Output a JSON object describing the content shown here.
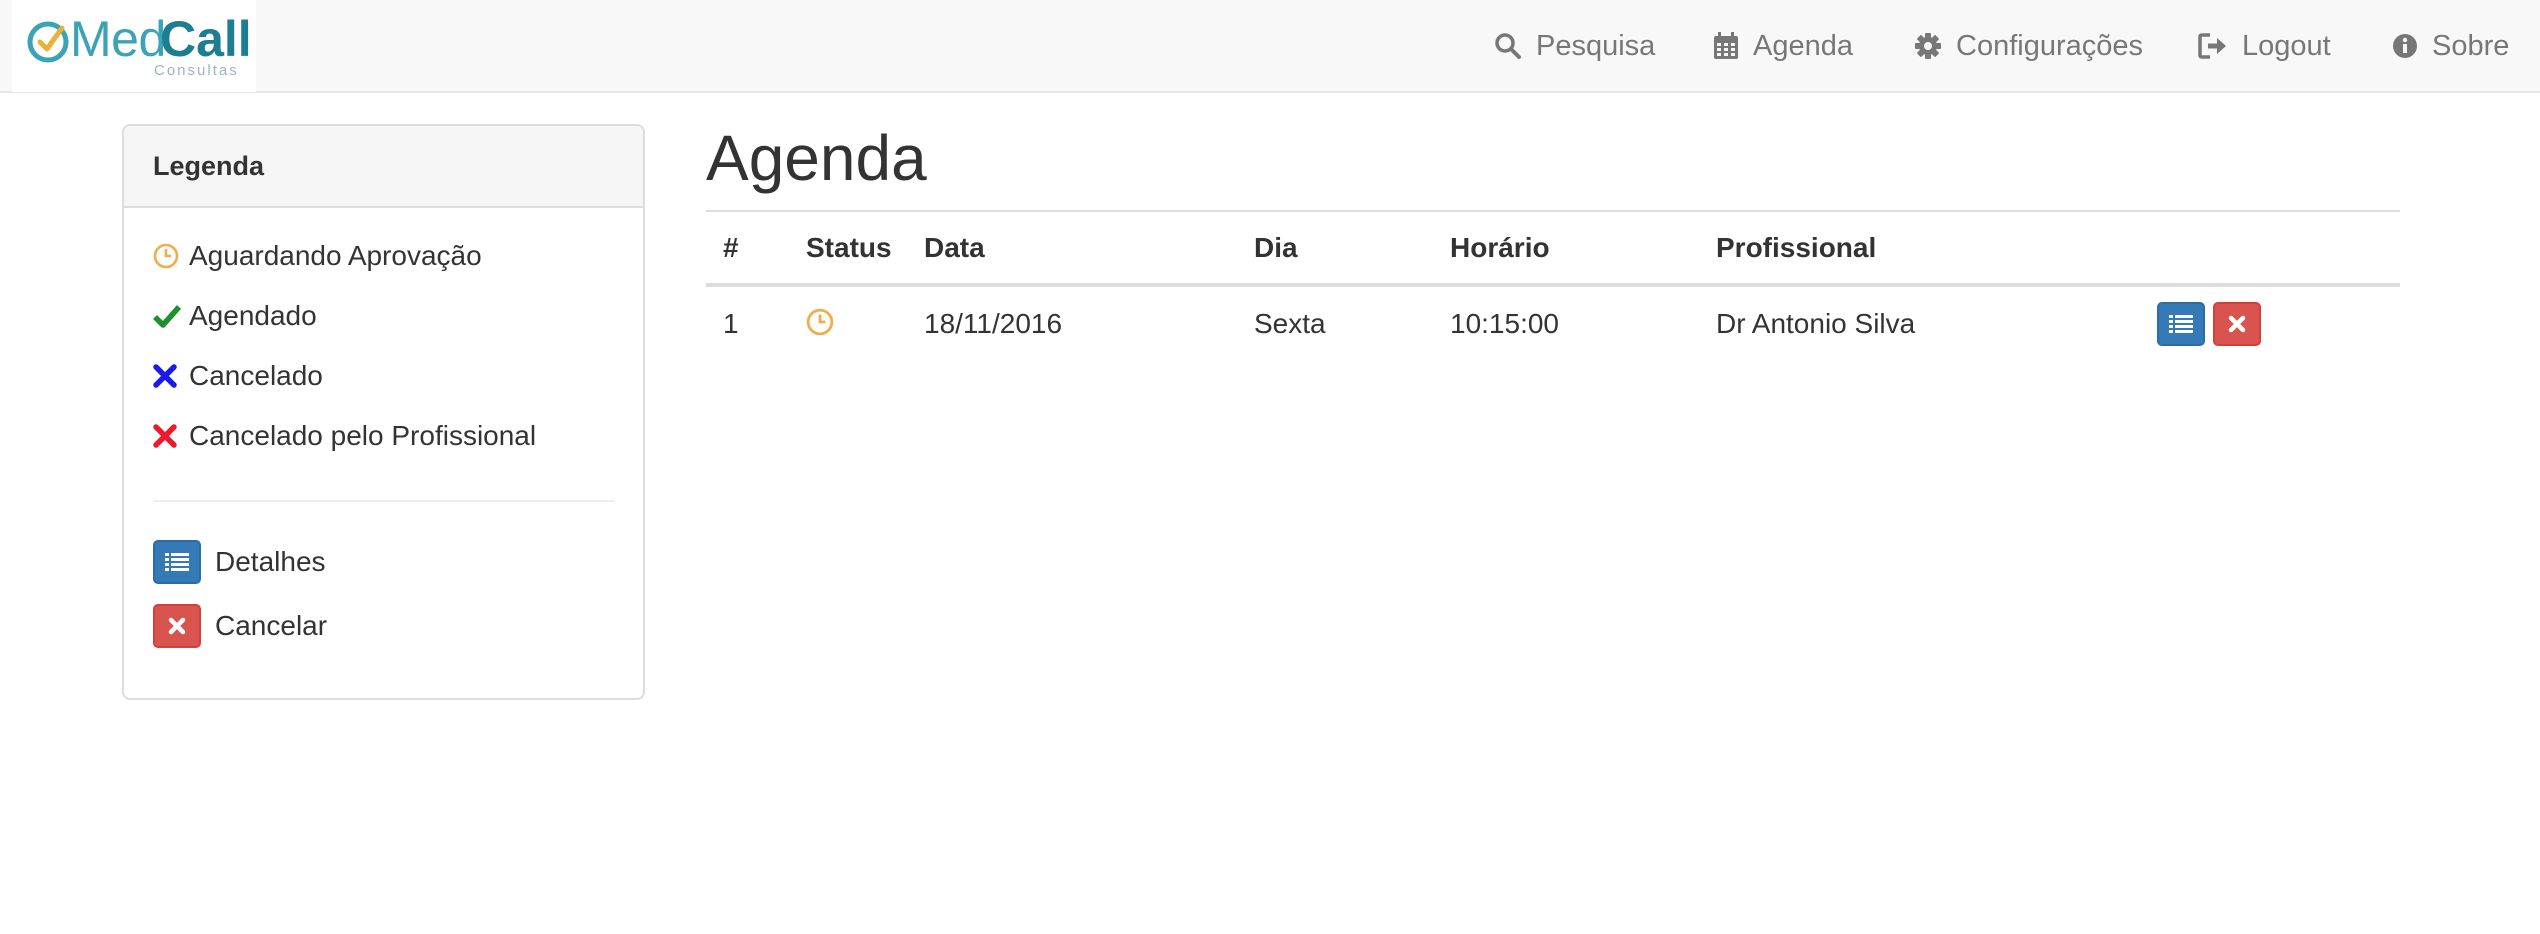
{
  "brand": {
    "med": "Med",
    "call": "Call",
    "sub": "Consultas"
  },
  "nav": {
    "items": [
      {
        "label": "Pesquisa",
        "icon": "search-icon"
      },
      {
        "label": "Agenda",
        "icon": "calendar-icon"
      },
      {
        "label": "Configurações",
        "icon": "gear-icon"
      },
      {
        "label": "Logout",
        "icon": "logout-icon"
      },
      {
        "label": "Sobre",
        "icon": "info-icon"
      }
    ]
  },
  "legend": {
    "title": "Legenda",
    "statuses": [
      {
        "label": "Aguardando Aprovação",
        "icon": "clock-icon",
        "color": "#f0ad4e"
      },
      {
        "label": "Agendado",
        "icon": "check-icon",
        "color": "#1e8f2d"
      },
      {
        "label": "Cancelado",
        "icon": "x-icon",
        "color": "#1a1aee"
      },
      {
        "label": "Cancelado pelo Profissional",
        "icon": "x-icon",
        "color": "#ee1a2a"
      }
    ],
    "actions": [
      {
        "label": "Detalhes",
        "icon": "list-icon",
        "color": "#337ab7"
      },
      {
        "label": "Cancelar",
        "icon": "x-icon",
        "color": "#d9534f"
      }
    ]
  },
  "main": {
    "title": "Agenda",
    "columns": [
      "#",
      "Status",
      "Data",
      "Dia",
      "Horário",
      "Profissional"
    ],
    "rows": [
      {
        "num": "1",
        "status": "clock-icon",
        "data": "18/11/2016",
        "dia": "Sexta",
        "horario": "10:15:00",
        "profissional": "Dr Antonio Silva"
      }
    ]
  }
}
